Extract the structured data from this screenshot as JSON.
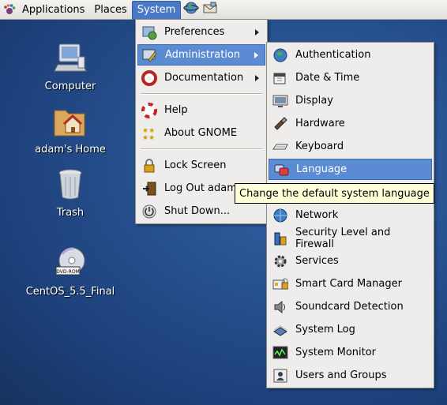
{
  "panel": {
    "menus": [
      "Applications",
      "Places",
      "System"
    ],
    "active_menu": "System"
  },
  "desktop": {
    "icons": [
      {
        "label": "Computer",
        "icon": "computer-icon"
      },
      {
        "label": "adam's Home",
        "icon": "home-folder-icon"
      },
      {
        "label": "Trash",
        "icon": "trash-icon"
      },
      {
        "label": "CentOS_5.5_Final",
        "icon": "dvd-icon"
      }
    ]
  },
  "system_menu": {
    "items": [
      {
        "label": "Preferences",
        "icon": "preferences-icon",
        "submenu": true
      },
      {
        "label": "Administration",
        "icon": "administration-icon",
        "submenu": true,
        "selected": true
      },
      {
        "label": "Documentation",
        "icon": "documentation-icon",
        "submenu": true
      },
      {
        "label": "Help",
        "icon": "help-icon"
      },
      {
        "label": "About GNOME",
        "icon": "about-gnome-icon"
      },
      {
        "label": "Lock Screen",
        "icon": "lock-icon"
      },
      {
        "label": "Log Out adam...",
        "icon": "logout-icon"
      },
      {
        "label": "Shut Down...",
        "icon": "shutdown-icon"
      }
    ]
  },
  "admin_menu": {
    "items": [
      {
        "label": "Authentication",
        "icon": "authentication-icon"
      },
      {
        "label": "Date & Time",
        "icon": "date-time-icon"
      },
      {
        "label": "Display",
        "icon": "display-icon"
      },
      {
        "label": "Hardware",
        "icon": "hardware-icon"
      },
      {
        "label": "Keyboard",
        "icon": "keyboard-icon"
      },
      {
        "label": "Language",
        "icon": "language-icon",
        "selected": true
      },
      {
        "label": "Network",
        "icon": "network-icon"
      },
      {
        "label": "Security Level and Firewall",
        "icon": "security-icon"
      },
      {
        "label": "Services",
        "icon": "services-icon"
      },
      {
        "label": "Smart Card Manager",
        "icon": "smartcard-icon"
      },
      {
        "label": "Soundcard Detection",
        "icon": "soundcard-icon"
      },
      {
        "label": "System Log",
        "icon": "system-log-icon"
      },
      {
        "label": "System Monitor",
        "icon": "system-monitor-icon"
      },
      {
        "label": "Users and Groups",
        "icon": "users-groups-icon"
      }
    ]
  },
  "tooltip": "Change the default system language",
  "colors": {
    "selection": "#5a8bd3",
    "menu_bg": "#eeedeb",
    "desktop": "#27508f"
  }
}
